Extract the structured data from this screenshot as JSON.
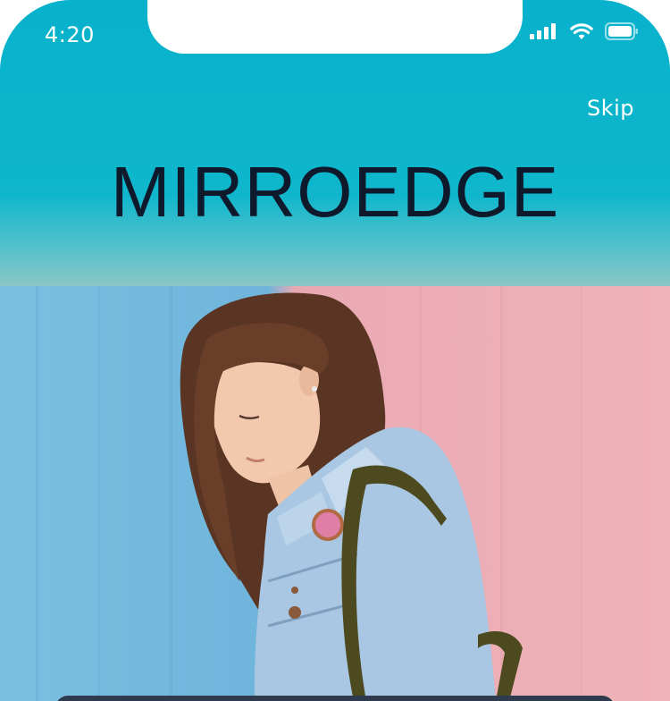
{
  "status_bar": {
    "time": "4:20",
    "icons": [
      "cellular-signal-icon",
      "wifi-icon",
      "battery-icon"
    ]
  },
  "header": {
    "skip_label": "Skip",
    "app_name": "MIRROEDGE"
  },
  "hero": {
    "image_description_icon": "hero-photo"
  },
  "colors": {
    "header_bg": "#0db2cb",
    "logo_text": "#0e1a2c",
    "wall_blue": "#74b9de",
    "wall_pink": "#efb1b7",
    "sheet": "#2e3a4e"
  }
}
